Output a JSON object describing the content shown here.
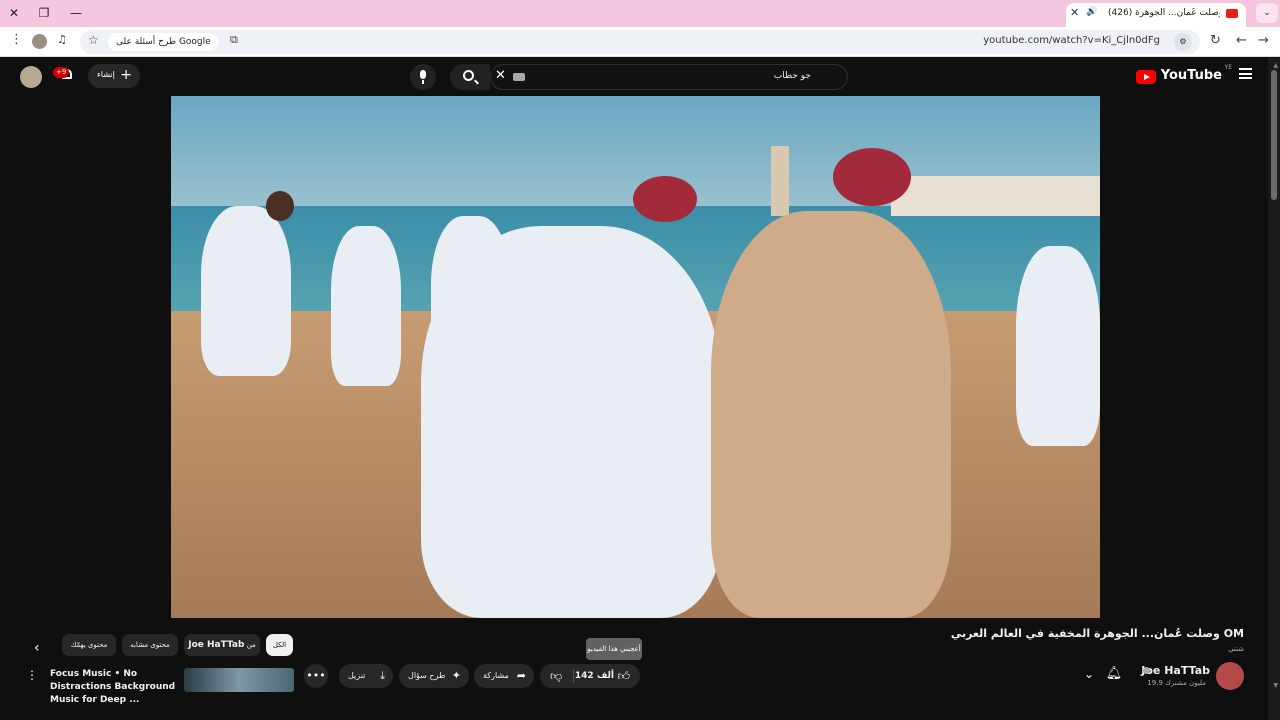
{
  "browser": {
    "tab_title": "(426) وصلت عُمان... الجوهرة",
    "url": "youtube.com/watch?v=Ki_Cjln0dFg",
    "google_chip": "طرح أسئلة على Google"
  },
  "header": {
    "logo_text": "YouTube",
    "country_code": "YE",
    "search_query": "جو حطاب",
    "create_label": "إنشاء",
    "notifications_badge": "+9"
  },
  "video": {
    "title": "وصلت عُمان... الجوهرة المخفية في العالم العربي OM",
    "tag": "شنتي",
    "channel_name": "Joe HaTTab",
    "subscribers": "19.9 مليون مشترك",
    "likes": "142 ألف",
    "like_tooltip": "أعجبني هذا الفيديو",
    "share_label": "مشاركة",
    "ask_label": "طرح سؤال",
    "download_label": "تنزيل"
  },
  "chips": {
    "all": "الكل",
    "from_prefix": "من",
    "from_channel": "Joe HaTTab",
    "related": "محتوى مشابه",
    "for_you": "محتوى يهمّك"
  },
  "recommended": {
    "title": "Focus Music • No Distractions Background Music for Deep ..."
  },
  "colors": {
    "accent": "#ff0000",
    "background": "#0f0f0f",
    "tab_strip": "#f4c6e0"
  }
}
